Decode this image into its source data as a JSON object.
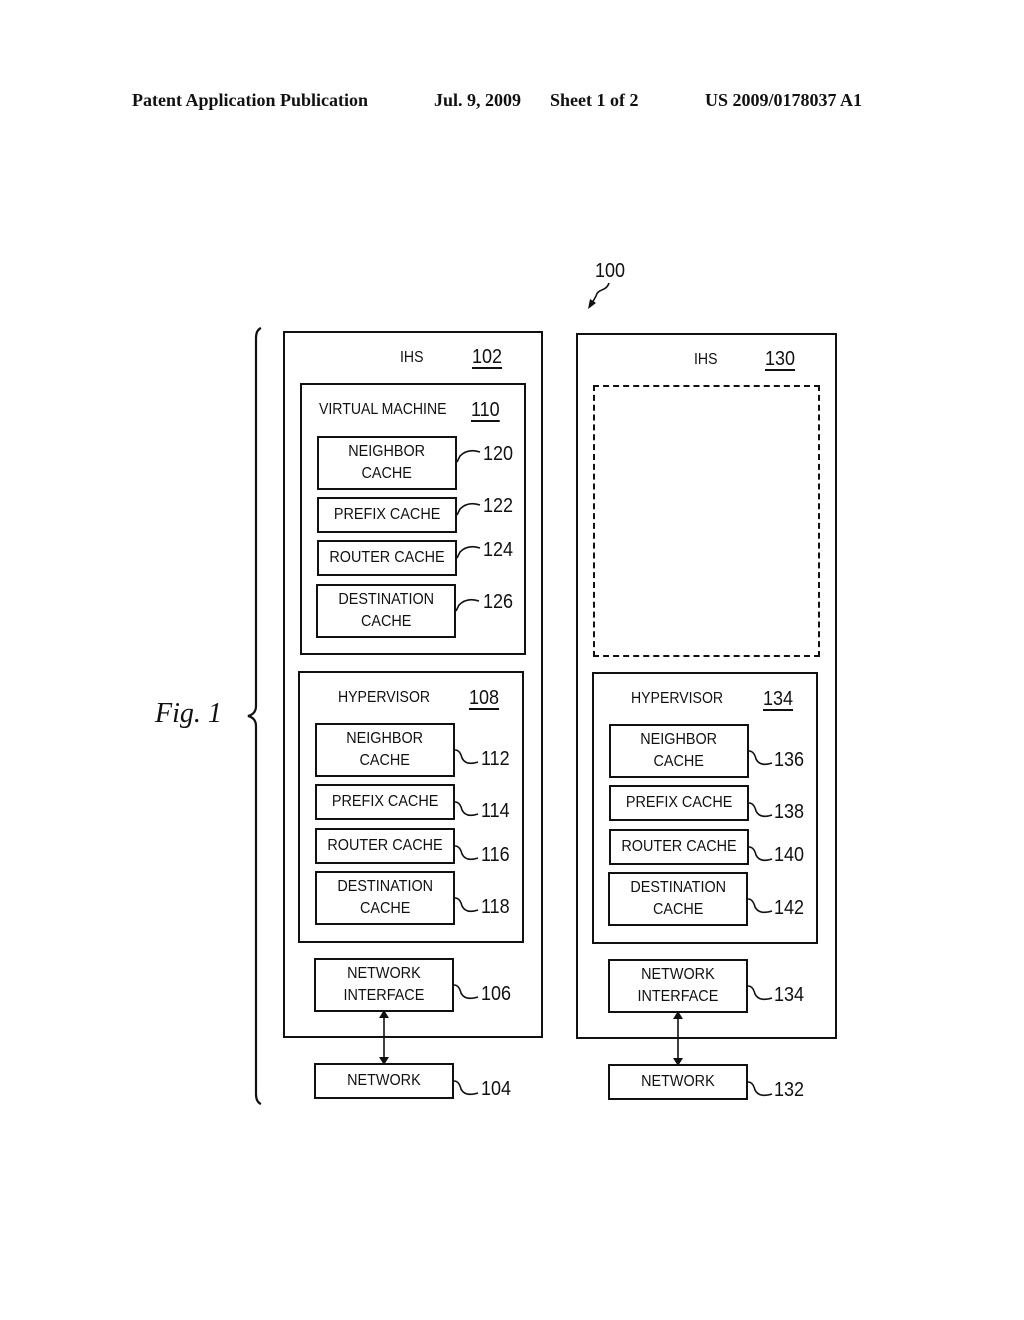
{
  "header": {
    "publication": "Patent Application Publication",
    "date": "Jul. 9, 2009",
    "sheet": "Sheet 1 of 2",
    "number": "US 2009/0178037 A1"
  },
  "figure": {
    "label": "Fig. 1",
    "system_ref": "100"
  },
  "ihs_left": {
    "title": "IHS",
    "ref": "102",
    "virtual_machine": {
      "title": "VIRTUAL MACHINE",
      "ref": "110",
      "caches": [
        {
          "label": "NEIGHBOR\nCACHE",
          "ref": "120"
        },
        {
          "label": "PREFIX CACHE",
          "ref": "122"
        },
        {
          "label": "ROUTER CACHE",
          "ref": "124"
        },
        {
          "label": "DESTINATION\nCACHE",
          "ref": "126"
        }
      ]
    },
    "hypervisor": {
      "title": "HYPERVISOR",
      "ref": "108",
      "caches": [
        {
          "label": "NEIGHBOR\nCACHE",
          "ref": "112"
        },
        {
          "label": "PREFIX CACHE",
          "ref": "114"
        },
        {
          "label": "ROUTER CACHE",
          "ref": "116"
        },
        {
          "label": "DESTINATION\nCACHE",
          "ref": "118"
        }
      ]
    },
    "network_interface": {
      "label": "NETWORK\nINTERFACE",
      "ref": "106"
    },
    "network": {
      "label": "NETWORK",
      "ref": "104"
    }
  },
  "ihs_right": {
    "title": "IHS",
    "ref": "130",
    "hypervisor": {
      "title": "HYPERVISOR",
      "ref": "134",
      "caches": [
        {
          "label": "NEIGHBOR\nCACHE",
          "ref": "136"
        },
        {
          "label": "PREFIX CACHE",
          "ref": "138"
        },
        {
          "label": "ROUTER CACHE",
          "ref": "140"
        },
        {
          "label": "DESTINATION\nCACHE",
          "ref": "142"
        }
      ]
    },
    "network_interface": {
      "label": "NETWORK\nINTERFACE",
      "ref": "134"
    },
    "network": {
      "label": "NETWORK",
      "ref": "132"
    }
  }
}
